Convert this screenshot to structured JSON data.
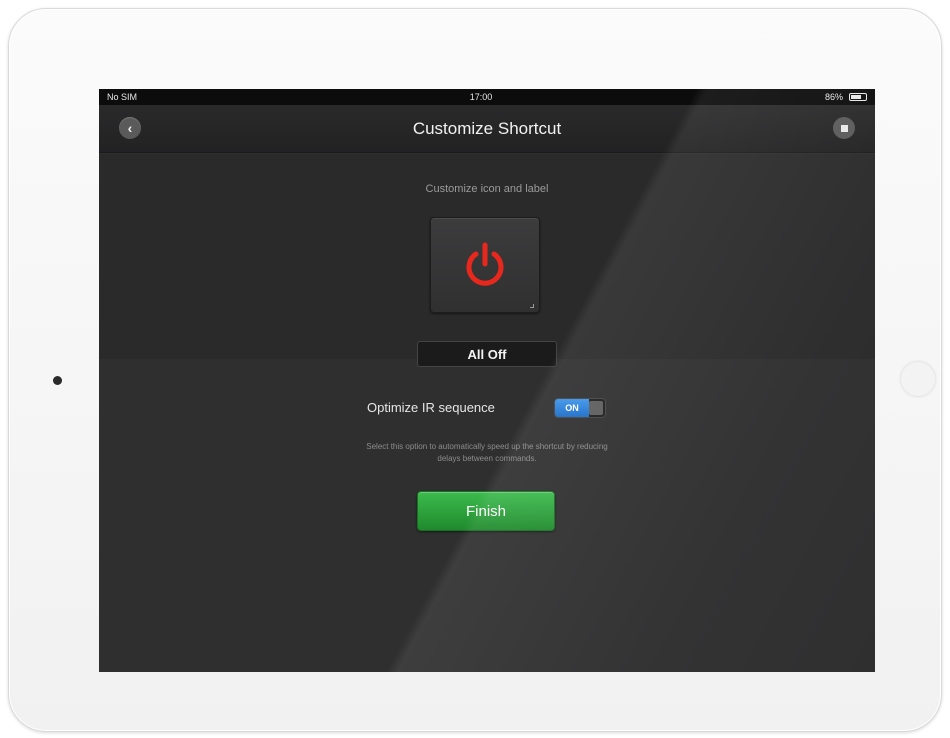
{
  "status_bar": {
    "carrier": "No SIM",
    "time": "17:00",
    "battery": "86%"
  },
  "nav": {
    "title": "Customize Shortcut",
    "back_icon": "chevron-left-icon",
    "home_icon": "home-icon"
  },
  "customize": {
    "subtitle": "Customize icon and label",
    "icon": "power-icon",
    "icon_color": "#e8271d",
    "label_value": "All Off"
  },
  "optimize": {
    "label": "Optimize IR sequence",
    "toggle_state": "ON",
    "help_text": "Select this option to automatically speed up the shortcut by reducing delays between commands."
  },
  "finish": {
    "label": "Finish",
    "color": "#2aa63a"
  }
}
